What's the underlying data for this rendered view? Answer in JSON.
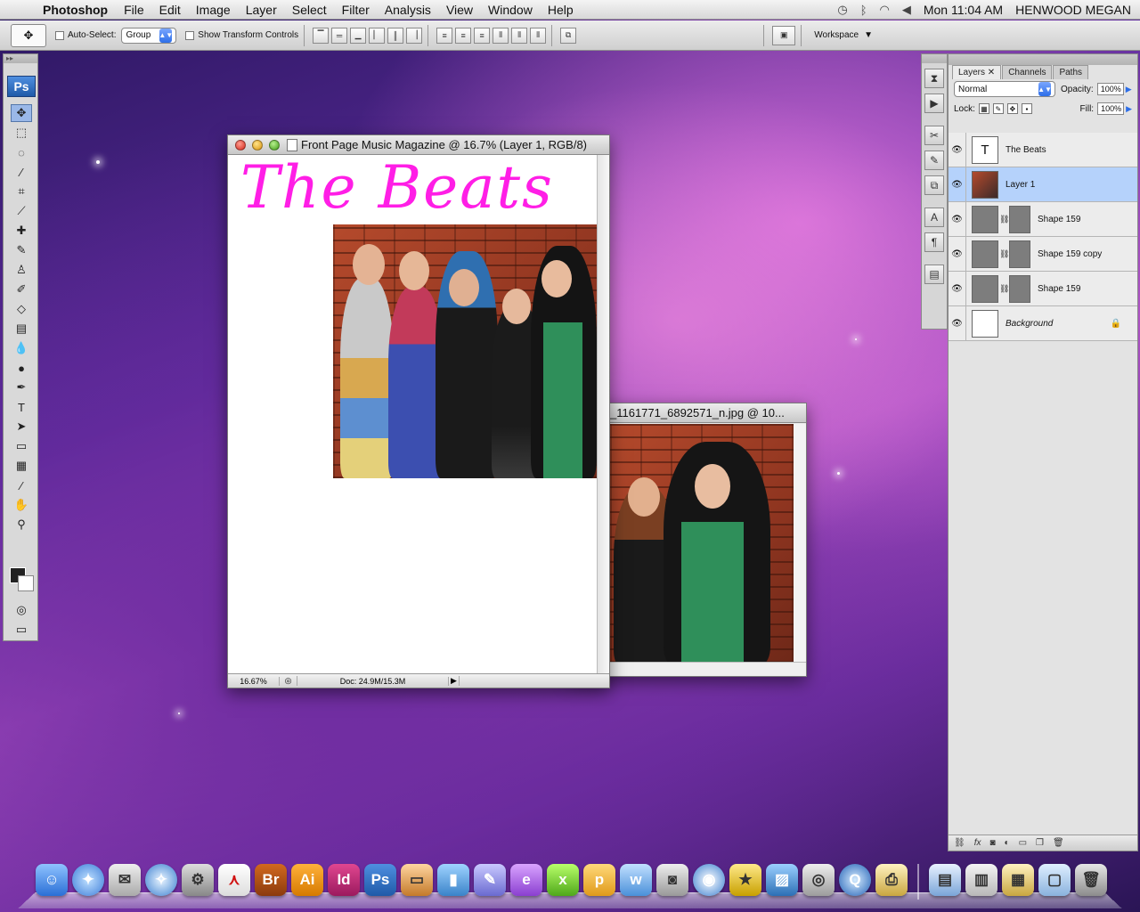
{
  "menubar": {
    "app_name": "Photoshop",
    "menus": [
      "File",
      "Edit",
      "Image",
      "Layer",
      "Select",
      "Filter",
      "Analysis",
      "View",
      "Window",
      "Help"
    ],
    "clock": "Mon 11:04 AM",
    "user": "HENWOOD MEGAN"
  },
  "options_bar": {
    "auto_select_label": "Auto-Select:",
    "auto_select_value": "Group",
    "transform_label": "Show Transform Controls",
    "workspace_label": "Workspace"
  },
  "tools": {
    "logo": "Ps"
  },
  "doc_main": {
    "title": "Front Page Music Magazine @ 16.7% (Layer 1, RGB/8)",
    "headline": "The Beats",
    "headline_color": "#ff1ee6",
    "zoom": "16.67%",
    "doc_size": "Doc: 24.9M/15.3M"
  },
  "doc_photo": {
    "title": "_1161771_6892571_n.jpg @ 10..."
  },
  "layers_panel": {
    "tabs": [
      "Layers",
      "Channels",
      "Paths"
    ],
    "blend_mode": "Normal",
    "opacity_label": "Opacity:",
    "opacity_value": "100%",
    "lock_label": "Lock:",
    "fill_label": "Fill:",
    "fill_value": "100%",
    "layers": [
      {
        "name": "The Beats",
        "kind": "text",
        "selected": false
      },
      {
        "name": "Layer 1",
        "kind": "image",
        "selected": true
      },
      {
        "name": "Shape 159",
        "kind": "shape",
        "selected": false
      },
      {
        "name": "Shape 159 copy",
        "kind": "shape",
        "selected": false
      },
      {
        "name": "Shape 159",
        "kind": "shape",
        "selected": false
      },
      {
        "name": "Background",
        "kind": "background",
        "selected": false
      }
    ]
  },
  "dock": {
    "labels": [
      "Br",
      "Ai",
      "Id",
      "Ps"
    ]
  }
}
